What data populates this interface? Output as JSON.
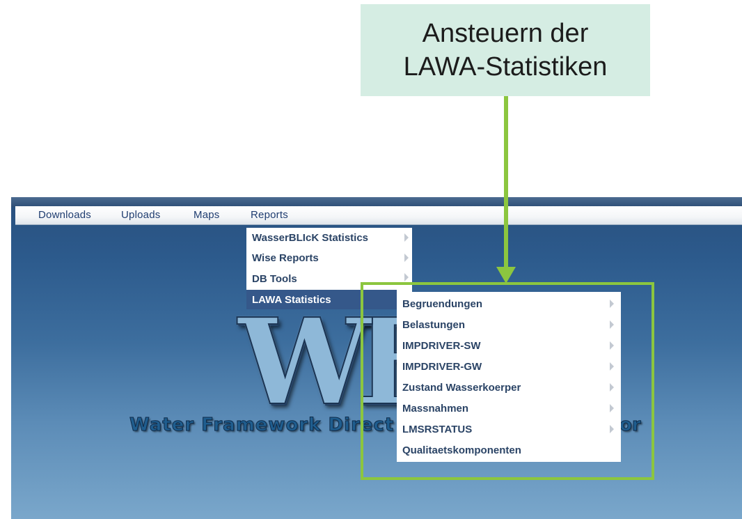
{
  "callout": {
    "line1": "Ansteuern der",
    "line2": "LAWA-Statistiken"
  },
  "menubar": {
    "items": [
      "Downloads",
      "Uploads",
      "Maps",
      "Reports"
    ]
  },
  "reports_menu": {
    "items": [
      {
        "label": "WasserBLIcK Statistics",
        "has_submenu": true
      },
      {
        "label": "Wise Reports",
        "has_submenu": true
      },
      {
        "label": "DB Tools",
        "has_submenu": true
      },
      {
        "label": "LAWA Statistics",
        "has_submenu": true,
        "active": true
      }
    ]
  },
  "lawa_submenu": {
    "items": [
      {
        "label": "Begruendungen",
        "has_submenu": true
      },
      {
        "label": "Belastungen",
        "has_submenu": true
      },
      {
        "label": "IMPDRIVER-SW",
        "has_submenu": true
      },
      {
        "label": "IMPDRIVER-GW",
        "has_submenu": true
      },
      {
        "label": "Zustand Wasserkoerper",
        "has_submenu": true
      },
      {
        "label": "Massnahmen",
        "has_submenu": true
      },
      {
        "label": "LMSRSTATUS",
        "has_submenu": true
      },
      {
        "label": "Qualitaetskomponenten",
        "has_submenu": false
      }
    ]
  },
  "logo": {
    "letters": "WF",
    "tagline_start": "Water Framework Direct",
    "tagline_end": "or"
  },
  "colors": {
    "highlight": "#8cc63f",
    "callout_bg": "#d5ede3",
    "menu_active": "#35588a",
    "menu_text": "#2b4466"
  }
}
